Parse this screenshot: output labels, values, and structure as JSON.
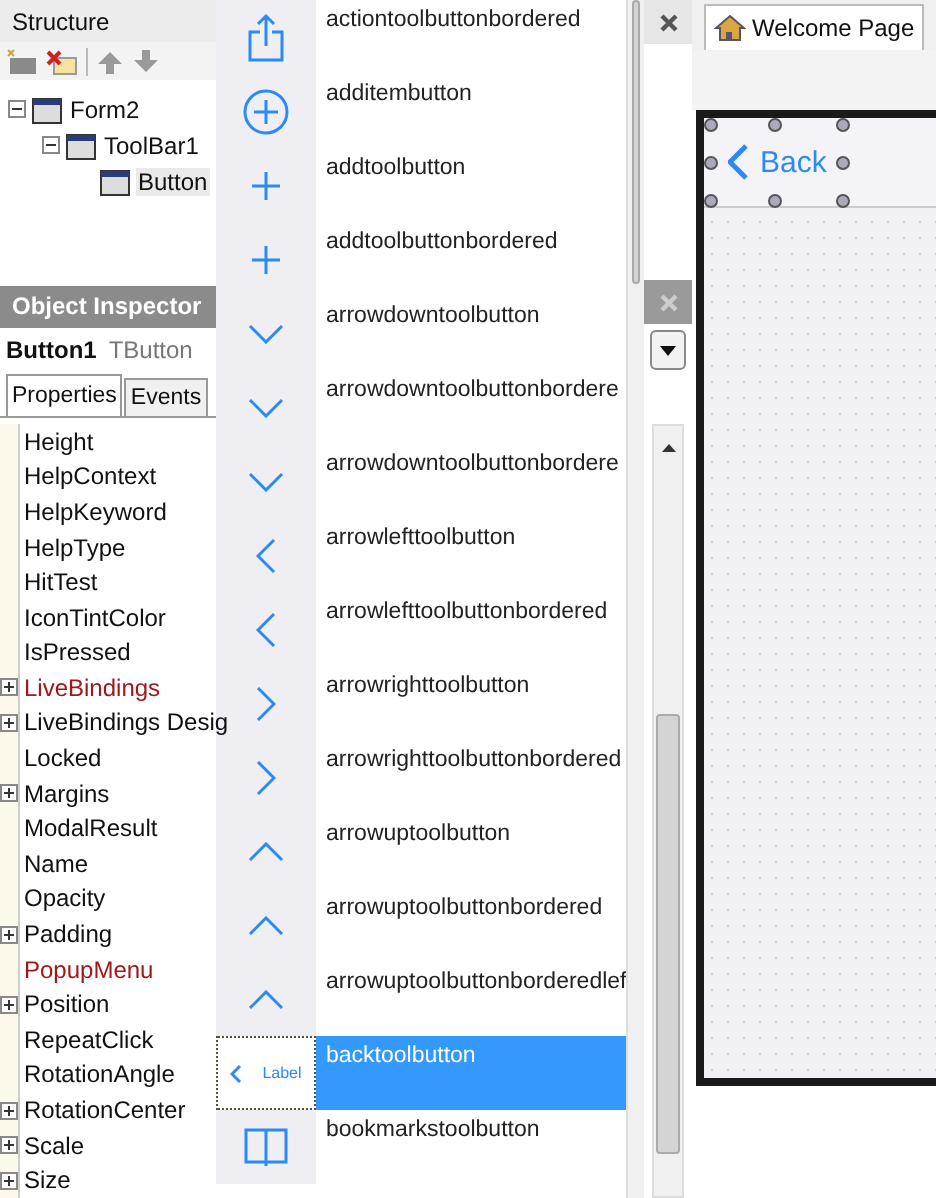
{
  "structure": {
    "title": "Structure",
    "tree": [
      {
        "label": "Form2",
        "expanded": true,
        "children": [
          {
            "label": "ToolBar1",
            "expanded": true,
            "children": [
              {
                "label": "Button",
                "selected": true
              }
            ]
          }
        ]
      }
    ]
  },
  "object_inspector": {
    "title": "Object Inspector",
    "component_name": "Button1",
    "component_type": "TButton",
    "tabs": [
      {
        "label": "Properties",
        "selected": true
      },
      {
        "label": "Events",
        "selected": false
      }
    ],
    "properties": [
      {
        "name": "Height",
        "expandable": false,
        "linked": false
      },
      {
        "name": "HelpContext",
        "expandable": false,
        "linked": false
      },
      {
        "name": "HelpKeyword",
        "expandable": false,
        "linked": false
      },
      {
        "name": "HelpType",
        "expandable": false,
        "linked": false
      },
      {
        "name": "HitTest",
        "expandable": false,
        "linked": false
      },
      {
        "name": "IconTintColor",
        "expandable": false,
        "linked": false
      },
      {
        "name": "IsPressed",
        "expandable": false,
        "linked": false
      },
      {
        "name": "LiveBindings",
        "expandable": true,
        "linked": true
      },
      {
        "name": "LiveBindings Desig",
        "expandable": true,
        "linked": false
      },
      {
        "name": "Locked",
        "expandable": false,
        "linked": false
      },
      {
        "name": "Margins",
        "expandable": true,
        "linked": false
      },
      {
        "name": "ModalResult",
        "expandable": false,
        "linked": false
      },
      {
        "name": "Name",
        "expandable": false,
        "linked": false
      },
      {
        "name": "Opacity",
        "expandable": false,
        "linked": false
      },
      {
        "name": "Padding",
        "expandable": true,
        "linked": false
      },
      {
        "name": "PopupMenu",
        "expandable": false,
        "linked": true
      },
      {
        "name": "Position",
        "expandable": true,
        "linked": false
      },
      {
        "name": "RepeatClick",
        "expandable": false,
        "linked": false
      },
      {
        "name": "RotationAngle",
        "expandable": false,
        "linked": false
      },
      {
        "name": "RotationCenter",
        "expandable": true,
        "linked": false
      },
      {
        "name": "Scale",
        "expandable": true,
        "linked": false
      },
      {
        "name": "Size",
        "expandable": true,
        "linked": false
      }
    ]
  },
  "style_lookup": [
    {
      "label": "actiontoolbuttonbordered",
      "kind": "share",
      "selected": false
    },
    {
      "label": "additembutton",
      "kind": "add-circle",
      "selected": false
    },
    {
      "label": "addtoolbutton",
      "kind": "plus",
      "selected": false
    },
    {
      "label": "addtoolbuttonbordered",
      "kind": "plus",
      "selected": false
    },
    {
      "label": "arrowdowntoolbutton",
      "kind": "down",
      "selected": false
    },
    {
      "label": "arrowdowntoolbuttonbordere",
      "kind": "down",
      "selected": false
    },
    {
      "label": "arrowdowntoolbuttonbordere",
      "kind": "down",
      "selected": false
    },
    {
      "label": "arrowlefttoolbutton",
      "kind": "left",
      "selected": false
    },
    {
      "label": "arrowlefttoolbuttonbordered",
      "kind": "left",
      "selected": false
    },
    {
      "label": "arrowrighttoolbutton",
      "kind": "right",
      "selected": false
    },
    {
      "label": "arrowrighttoolbuttonbordered",
      "kind": "right",
      "selected": false
    },
    {
      "label": "arrowuptoolbutton",
      "kind": "up",
      "selected": false
    },
    {
      "label": "arrowuptoolbuttonbordered",
      "kind": "up",
      "selected": false
    },
    {
      "label": "arrowuptoolbuttonborderedlef",
      "kind": "up",
      "selected": false
    },
    {
      "label": "backtoolbutton",
      "kind": "back",
      "preview_label": "Label",
      "selected": true
    },
    {
      "label": "bookmarkstoolbutton",
      "kind": "book",
      "selected": false
    }
  ],
  "editor": {
    "tab": "Welcome Page",
    "button": "Back"
  }
}
